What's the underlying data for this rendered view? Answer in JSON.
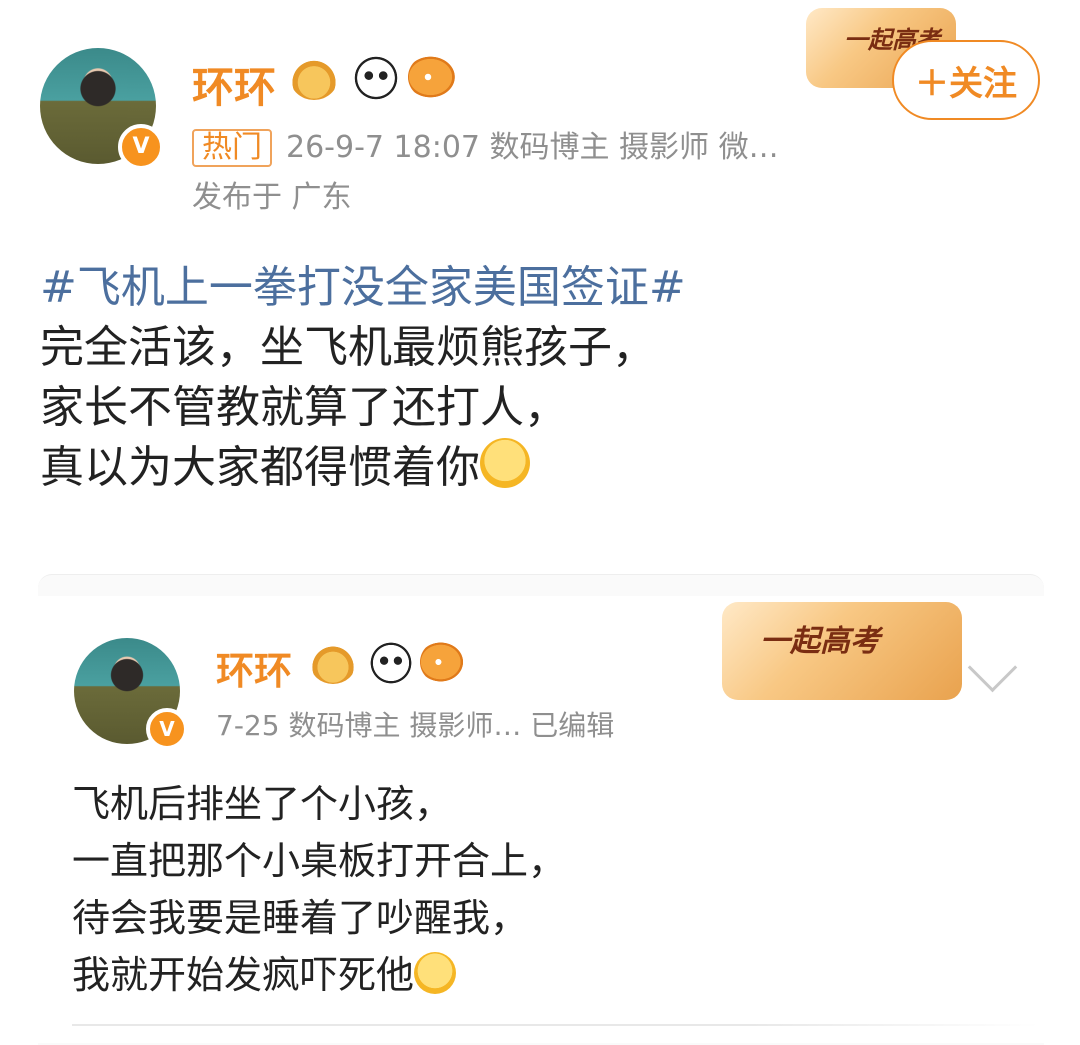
{
  "post": {
    "author": "环环",
    "hot_tag": "热门",
    "meta_line": "26-9-7 18:07  数码博主 摄影师 微…",
    "location": "发布于 广东",
    "follow_label": "＋关注",
    "banner_text": "一起高考",
    "hashtag": "#飞机上一拳打没全家美国签证#",
    "lines": [
      "完全活该，坐飞机最烦熊孩子，",
      "家长不管教就算了还打人，",
      "真以为大家都得惯着你"
    ]
  },
  "quoted": {
    "author": "环环",
    "meta_line": "7-25  数码博主 摄影师…  已编辑",
    "banner_text": "一起高考",
    "lines": [
      "飞机后排坐了个小孩，",
      "一直把那个小桌板打开合上，",
      "待会我要是睡着了吵醒我，",
      "我就开始发疯吓死他"
    ]
  },
  "badges": {
    "verified": "V",
    "icons": [
      "crown-badge-icon",
      "panda-badge-icon",
      "fish-badge-icon"
    ]
  },
  "colors": {
    "accent": "#f08a24",
    "hashtag": "#4c6f9e",
    "meta": "#8f8f8f"
  }
}
